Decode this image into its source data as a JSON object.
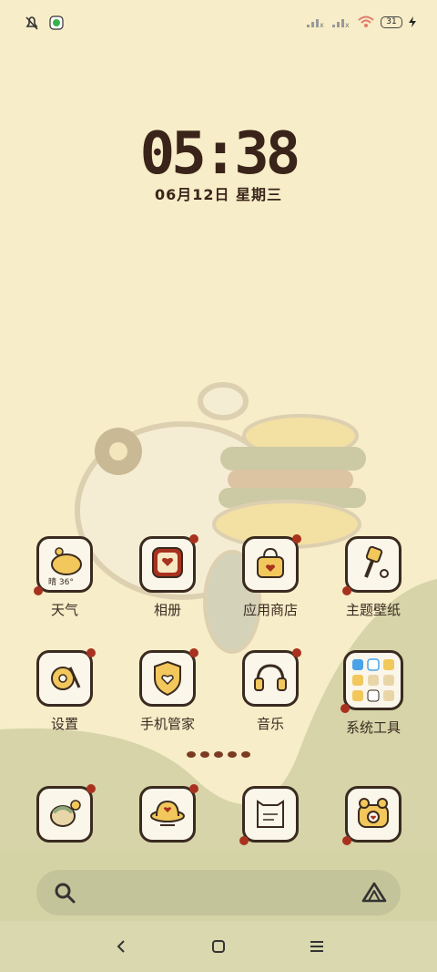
{
  "status_bar": {
    "left_icons": [
      "mute-bell-icon",
      "app-notification-icon"
    ],
    "right_icons": [
      "signal-icon",
      "signal-icon",
      "wifi-icon",
      "battery-icon",
      "charging-icon"
    ],
    "battery_level": "31"
  },
  "lock": {
    "time": "05:38",
    "date": "06月12日 星期三"
  },
  "apps_row1": [
    {
      "label": "天气",
      "badge": "晴 36°",
      "icon": "weather-icon"
    },
    {
      "label": "相册",
      "icon": "gallery-icon"
    },
    {
      "label": "应用商店",
      "icon": "app-store-icon"
    },
    {
      "label": "主题壁纸",
      "icon": "themes-icon"
    }
  ],
  "apps_row2": [
    {
      "label": "设置",
      "icon": "settings-icon"
    },
    {
      "label": "手机管家",
      "icon": "security-icon"
    },
    {
      "label": "音乐",
      "icon": "music-icon"
    },
    {
      "label": "系统工具",
      "icon": "system-tools-folder-icon"
    }
  ],
  "dock": [
    {
      "icon": "phone-icon"
    },
    {
      "icon": "messages-icon"
    },
    {
      "icon": "notes-icon"
    },
    {
      "icon": "camera-icon"
    }
  ],
  "page_indicator": {
    "count": 5,
    "active": 0
  },
  "search": {
    "left_icon": "search-icon",
    "right_icon": "assistant-icon"
  },
  "nav": {
    "back": "back-icon",
    "home": "home-icon",
    "menu": "recents-icon"
  },
  "colors": {
    "background": "#f7edc8",
    "hill": "#d5d4a8",
    "ink": "#3a241a",
    "accent_cherry": "#a8321f"
  }
}
